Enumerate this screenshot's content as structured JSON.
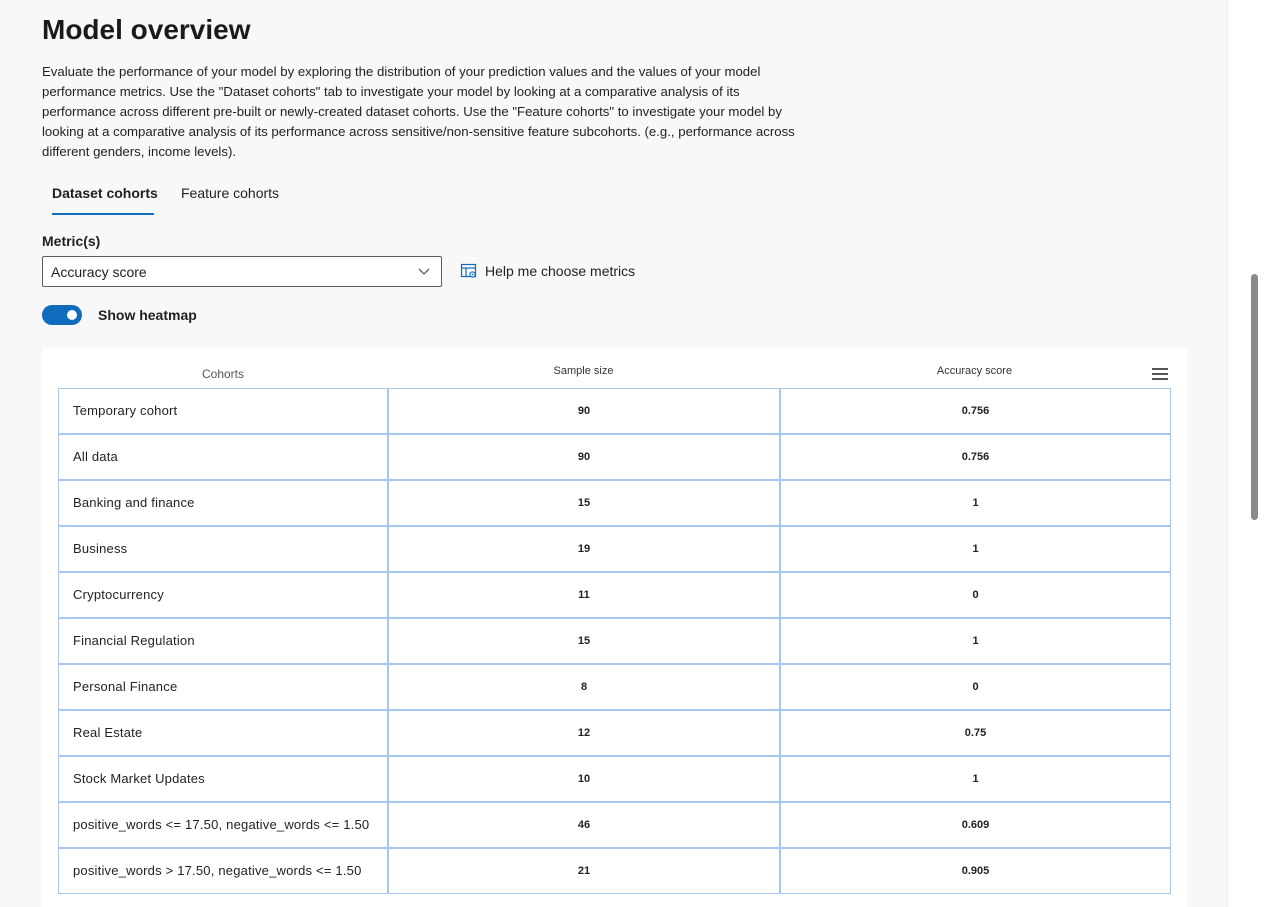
{
  "page": {
    "title": "Model overview",
    "description": "Evaluate the performance of your model by exploring the distribution of your prediction values and the values of your model performance metrics. Use the \"Dataset cohorts\" tab to investigate your model by looking at a comparative analysis of its performance across different pre-built or newly-created dataset cohorts. Use the \"Feature cohorts\" to investigate your model by looking at a comparative analysis of its performance across sensitive/non-sensitive feature subcohorts. (e.g., performance across different genders, income levels)."
  },
  "tabs": [
    {
      "label": "Dataset cohorts",
      "active": true
    },
    {
      "label": "Feature cohorts",
      "active": false
    }
  ],
  "metrics": {
    "label": "Metric(s)",
    "selected": "Accuracy score",
    "help_link": "Help me choose metrics",
    "help_icon": "help-choose-icon"
  },
  "heatmap_toggle": {
    "label": "Show heatmap",
    "on": true
  },
  "colors": {
    "accent": "#0f6cbd",
    "cell_border": "#a6c8ee"
  },
  "table": {
    "headers": {
      "cohorts": "Cohorts",
      "sample_size": "Sample size",
      "metric": "Accuracy score"
    },
    "menu_icon": "hamburger-menu-icon",
    "rows": [
      {
        "cohort": "Temporary cohort",
        "sample_size": "90",
        "accuracy": "0.756"
      },
      {
        "cohort": "All data",
        "sample_size": "90",
        "accuracy": "0.756"
      },
      {
        "cohort": "Banking and finance",
        "sample_size": "15",
        "accuracy": "1"
      },
      {
        "cohort": "Business",
        "sample_size": "19",
        "accuracy": "1"
      },
      {
        "cohort": "Cryptocurrency",
        "sample_size": "11",
        "accuracy": "0"
      },
      {
        "cohort": "Financial Regulation",
        "sample_size": "15",
        "accuracy": "1"
      },
      {
        "cohort": "Personal Finance",
        "sample_size": "8",
        "accuracy": "0"
      },
      {
        "cohort": "Real Estate",
        "sample_size": "12",
        "accuracy": "0.75"
      },
      {
        "cohort": "Stock Market Updates",
        "sample_size": "10",
        "accuracy": "1"
      },
      {
        "cohort": "positive_words <= 17.50, negative_words <= 1.50",
        "sample_size": "46",
        "accuracy": "0.609"
      },
      {
        "cohort": "positive_words > 17.50, negative_words <= 1.50",
        "sample_size": "21",
        "accuracy": "0.905"
      }
    ]
  }
}
